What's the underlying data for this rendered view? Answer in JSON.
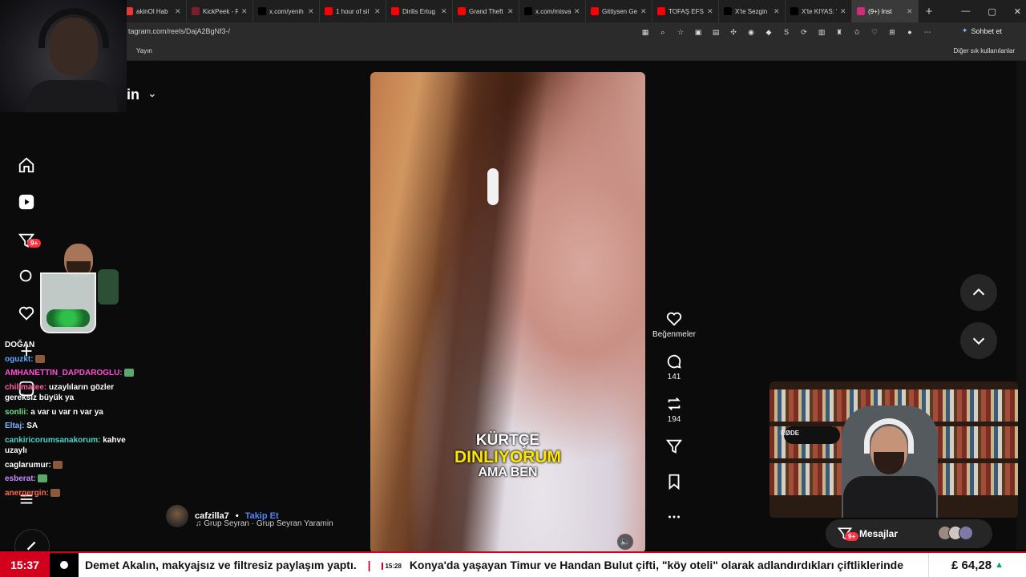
{
  "browser": {
    "tabs": [
      {
        "label": "akinOl Hab",
        "color": "#e53935"
      },
      {
        "label": "KickPeek - R",
        "color": "#7b1f2b"
      },
      {
        "label": "x.com/yenih",
        "color": "#000000"
      },
      {
        "label": "1 hour of sil",
        "color": "#ff0000"
      },
      {
        "label": "Dirilis Ertug",
        "color": "#ff0000"
      },
      {
        "label": "Grand Theft",
        "color": "#ff0000"
      },
      {
        "label": "x.com/misva",
        "color": "#000000"
      },
      {
        "label": "Gittiysen Ge",
        "color": "#ff0000"
      },
      {
        "label": "TOFAŞ EFSA",
        "color": "#ff0000"
      },
      {
        "label": "X'te Sezgin",
        "color": "#000000"
      },
      {
        "label": "X'te KIYAS: \"",
        "color": "#000000"
      },
      {
        "label": "(9+) Inst",
        "color": "#d62976",
        "active": true
      }
    ],
    "new_tab": "+",
    "window_controls": {
      "minimize": "—",
      "maximize": "▢",
      "close": "✕"
    },
    "url": "tagram.com/reels/DajA2BgNf3-/",
    "chat_button": "Sohbet et",
    "bookmark_left": "Yayın",
    "bookmark_right": "Diğer sık kullanılanlar"
  },
  "instagram": {
    "username_fragment": "in",
    "nav_icons": [
      "home-icon",
      "reels-icon",
      "notifications-icon",
      "search-icon",
      "heart-icon",
      "create-icon",
      "profile-icon",
      "more-icon"
    ],
    "notif_badge": "9+",
    "reel": {
      "caption_line1": "KÜRTÇE",
      "caption_line2": "DINLIYORUM",
      "caption_line3": "AMA BEN"
    },
    "actions": {
      "likes_label": "Beğenmeler",
      "comments_count": "141",
      "reposts_count": "194"
    },
    "author": {
      "name": "cafzilla7",
      "separator": "•",
      "follow": "Takip Et",
      "audio": "Grup Seyran · Grup Seyran Yaramin"
    },
    "messages": {
      "label": "Mesajlar",
      "badge": "9+"
    }
  },
  "chat": [
    {
      "user": "DOĞAN",
      "color": "#ffffff",
      "text": ""
    },
    {
      "user": "oguzkt:",
      "color": "#5aa8ff",
      "text": ""
    },
    {
      "user": "AMHANETTIN_DAPDAROGLU:",
      "color": "#ff4fd8",
      "text": ""
    },
    {
      "user": "chillmatee:",
      "color": "#ff5fa0",
      "text": "uzaylıların gözler gereksiz büyük ya"
    },
    {
      "user": "sonlii:",
      "color": "#6fe07a",
      "text": "a var u var n var ya"
    },
    {
      "user": "Eltaj:",
      "color": "#7fb6ff",
      "text": "SA"
    },
    {
      "user": "cankiricorumsanakorum:",
      "color": "#4fd6c8",
      "text": "kahve uzaylı"
    },
    {
      "user": "caglarumur:",
      "color": "#ffffff",
      "text": ""
    },
    {
      "user": "esberat:",
      "color": "#c58cff",
      "text": ""
    },
    {
      "user": "anergergin:",
      "color": "#ff6a4a",
      "text": ""
    }
  ],
  "webcam": {
    "mic_brand": "RØDE"
  },
  "ticker": {
    "time": "15:37",
    "headline1": "Demet Akalın, makyajsız ve filtresiz paylaşım yaptı.",
    "separator": "|",
    "timestamp2": "15:28",
    "headline2": "Konya'da yaşayan Timur ve Handan Bulut çifti, \"köy oteli\" olarak adlandırdıkları çiftliklerinde",
    "price": "£ 64,28",
    "price_trend": "▲"
  }
}
